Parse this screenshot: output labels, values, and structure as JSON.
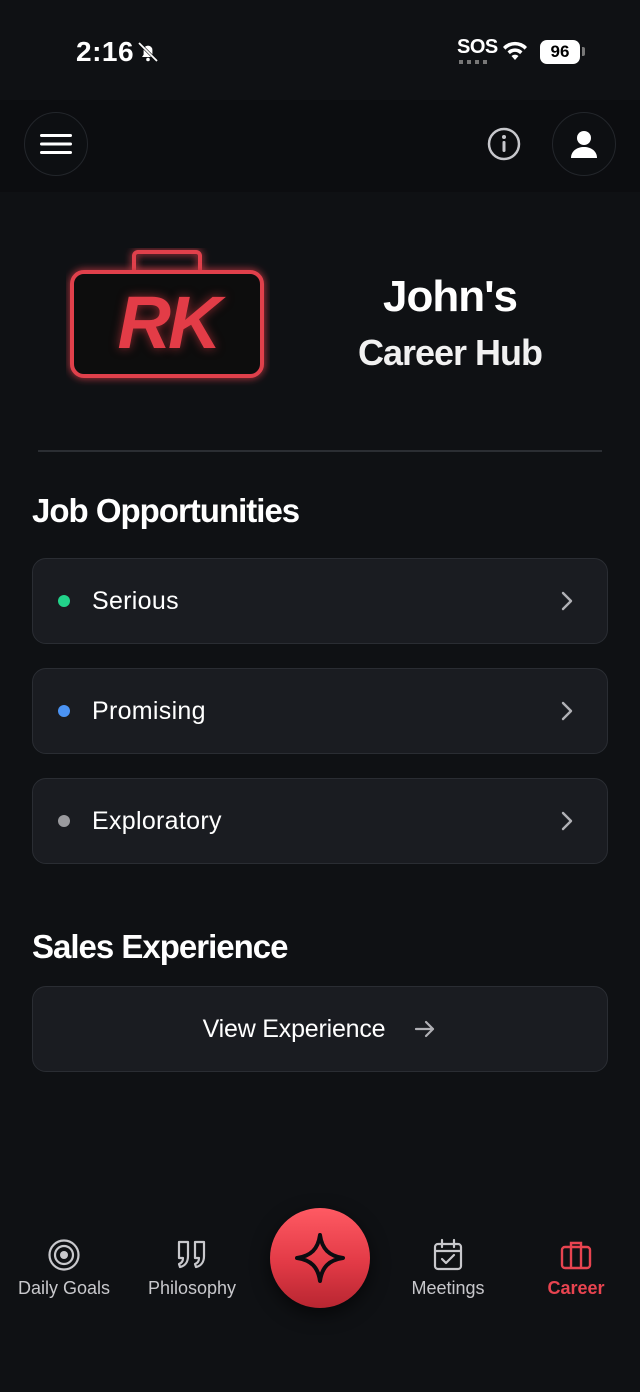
{
  "status_bar": {
    "time": "2:16",
    "carrier": "SOS",
    "battery": "96"
  },
  "header": {
    "logo_text": "RK",
    "title_line1": "John's",
    "title_line2": "Career Hub"
  },
  "jobs": {
    "title": "Job Opportunities",
    "items": [
      {
        "label": "Serious",
        "color": "#22d38a"
      },
      {
        "label": "Promising",
        "color": "#4b93f3"
      },
      {
        "label": "Exploratory",
        "color": "#9a9a9e"
      }
    ]
  },
  "sales": {
    "title": "Sales Experience",
    "button_label": "View Experience"
  },
  "bottom_nav": {
    "tabs": [
      {
        "label": "Daily Goals",
        "icon": "target-icon"
      },
      {
        "label": "Philosophy",
        "icon": "quote-icon"
      },
      {
        "label": "Meetings",
        "icon": "calendar-check-icon"
      },
      {
        "label": "Career",
        "icon": "briefcase-icon",
        "active": true
      }
    ],
    "center_icon": "sparkle-icon"
  },
  "colors": {
    "accent": "#e84450",
    "background": "#0f1114",
    "card": "#1a1c21"
  }
}
